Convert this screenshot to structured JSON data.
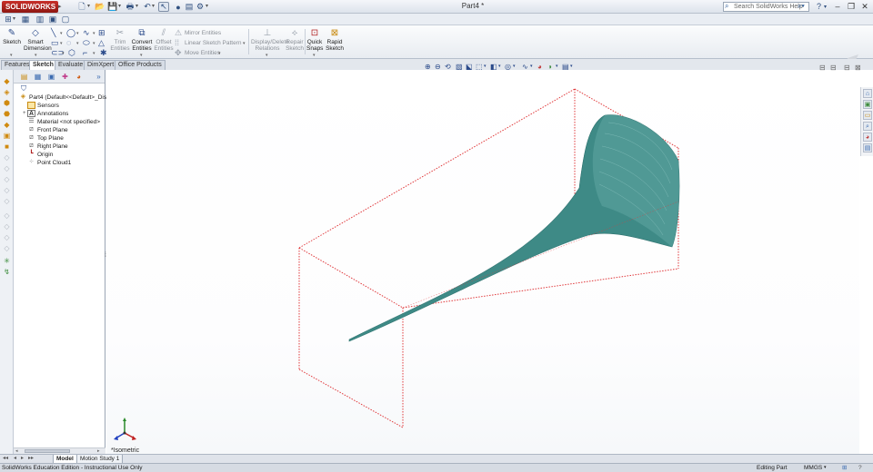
{
  "app": {
    "logo_text": "SOLIDWORKS",
    "document_title": "Part4 *",
    "search_placeholder": "Search SolidWorks Help"
  },
  "command_manager": {
    "sketch": "Sketch",
    "smart_dimension_1": "Smart",
    "smart_dimension_2": "Dimension",
    "trim_1": "Trim",
    "trim_2": "Entities",
    "convert_1": "Convert",
    "convert_2": "Entities",
    "offset_1": "Offset",
    "offset_2": "Entities",
    "mirror": "Mirror Entities",
    "linear_pattern": "Linear Sketch Pattern",
    "move": "Move Entities",
    "display_delete_1": "Display/Delete",
    "display_delete_2": "Relations",
    "repair_1": "Repair",
    "repair_2": "Sketch",
    "quick_snaps_1": "Quick",
    "quick_snaps_2": "Snaps",
    "rapid_sketch_1": "Rapid",
    "rapid_sketch_2": "Sketch"
  },
  "tabs": [
    "Features",
    "Sketch",
    "Evaluate",
    "DimXpert",
    "Office Products"
  ],
  "active_tab": "Sketch",
  "feature_tree": {
    "root": "Part4  (Default<<Default>_Disp",
    "items": [
      "Sensors",
      "Annotations",
      "Material <not specified>",
      "Front Plane",
      "Top Plane",
      "Right Plane",
      "Origin",
      "Point Cloud1"
    ]
  },
  "bottom_tabs": [
    "Model",
    "Motion Study 1"
  ],
  "active_bottom_tab": "Model",
  "view_orientation": "*Isometric",
  "status": {
    "left": "SolidWorks Education Edition - Instructional Use Only",
    "state": "Editing Part",
    "units": "MMGS"
  },
  "colors": {
    "model_fill": "#3e8a86",
    "bbox_line": "#e0393b"
  }
}
